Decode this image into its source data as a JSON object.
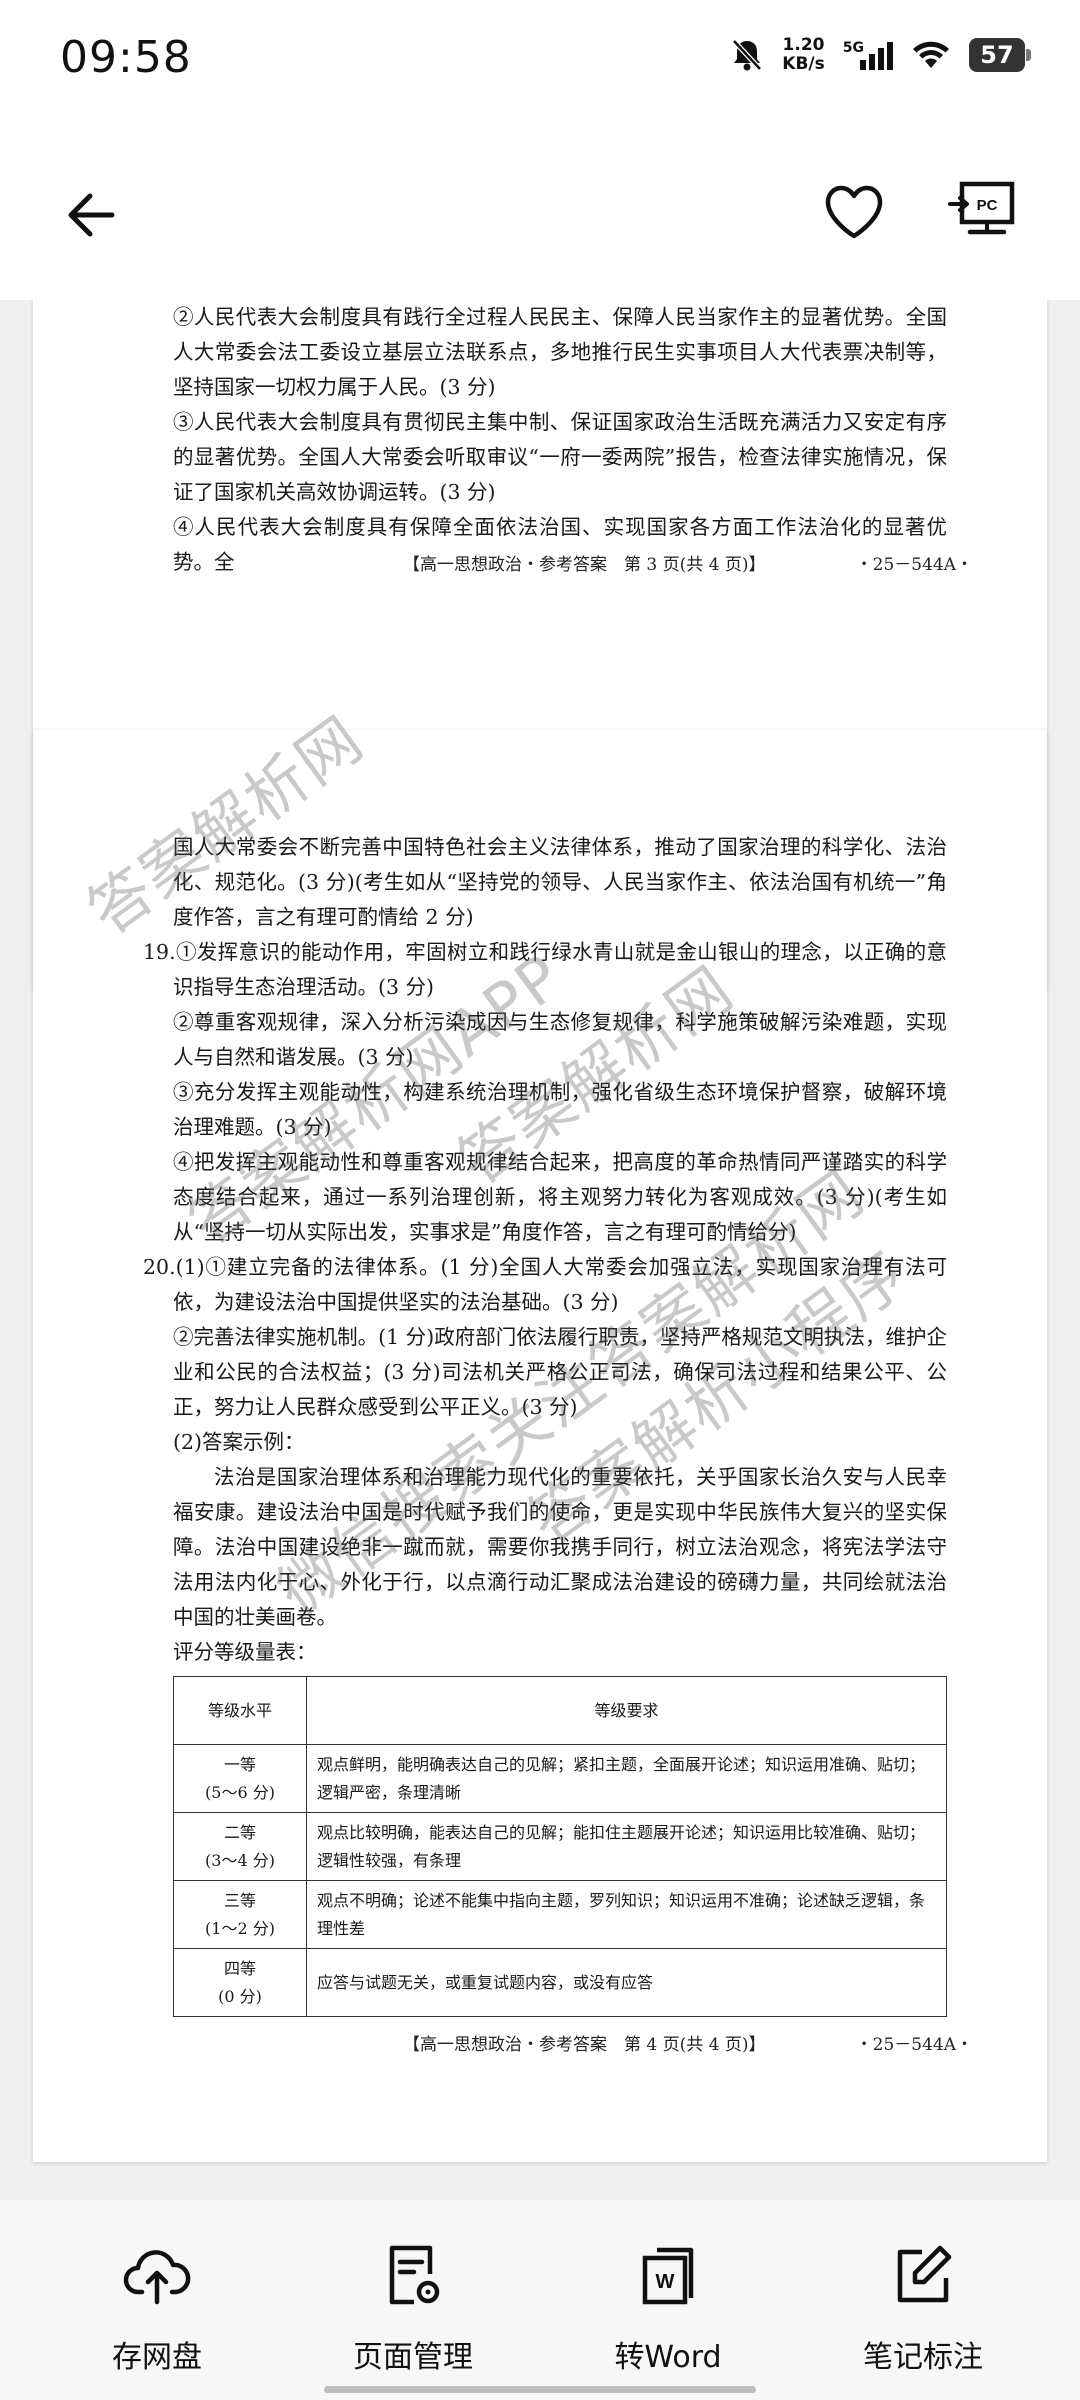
{
  "status": {
    "time": "09:58",
    "speed_value": "1.20",
    "speed_unit": "KB/s",
    "network": "5G",
    "battery": "57"
  },
  "icons": {
    "bell": "bell-off-icon",
    "signal": "signal-icon",
    "wifi": "wifi-icon",
    "battery": "battery-icon",
    "back": "back-arrow-icon",
    "favorite": "heart-icon",
    "cast": "pc-cast-icon"
  },
  "page3": {
    "lines": [
      "②人民代表大会制度具有践行全过程人民民主、保障人民当家作主的显著优势。全国人大常委会法工委设立基层立法联系点，多地推行民生实事项目人大代表票决制等，坚持国家一切权力属于人民。(3 分)",
      "③人民代表大会制度具有贯彻民主集中制、保证国家政治生活既充满活力又安定有序的显著优势。全国人大常委会听取审议“一府一委两院”报告，检查法律实施情况，保证了国家机关高效协调运转。(3 分)",
      "④人民代表大会制度具有保障全面依法治国、实现国家各方面工作法治化的显著优势。全"
    ],
    "footer_center": "【高一思想政治・参考答案　第 3 页(共 4 页)】",
    "footer_right": "・25－544A・"
  },
  "page4": {
    "intro": "国人大常委会不断完善中国特色社会主义法律体系，推动了国家治理的科学化、法治化、规范化。(3 分)(考生如从“坚持党的领导、人民当家作主、依法治国有机统一”角度作答，言之有理可酌情给 2 分)",
    "q19_num": "19.",
    "q19": [
      "①发挥意识的能动作用，牢固树立和践行绿水青山就是金山银山的理念，以正确的意识指导生态治理活动。(3 分)",
      "②尊重客观规律，深入分析污染成因与生态修复规律，科学施策破解污染难题，实现人与自然和谐发展。(3 分)",
      "③充分发挥主观能动性，构建系统治理机制，强化省级生态环境保护督察，破解环境治理难题。(3 分)",
      "④把发挥主观能动性和尊重客观规律结合起来，把高度的革命热情同严谨踏实的科学态度结合起来，通过一系列治理创新，将主观努力转化为客观成效。(3 分)(考生如从“坚持一切从实际出发，实事求是”角度作答，言之有理可酌情给分)"
    ],
    "q20_num": "20.",
    "q20": [
      "(1)①建立完备的法律体系。(1 分)全国人大常委会加强立法，实现国家治理有法可依，为建设法治中国提供坚实的法治基础。(3 分)",
      "②完善法律实施机制。(1 分)政府部门依法履行职责，坚持严格规范文明执法，维护企业和公民的合法权益；(3 分)司法机关严格公正司法，确保司法过程和结果公平、公正，努力让人民群众感受到公平正义。(3 分)",
      "(2)答案示例："
    ],
    "essay": "法治是国家治理体系和治理能力现代化的重要依托，关乎国家长治久安与人民幸福安康。建设法治中国是时代赋予我们的使命，更是实现中华民族伟大复兴的坚实保障。法治中国建设绝非一蹴而就，需要你我携手同行，树立法治观念，将宪法学法守法用法内化于心、外化于行，以点滴行动汇聚成法治建设的磅礴力量，共同绘就法治中国的壮美画卷。",
    "scale_label": "评分等级量表：",
    "table": {
      "headers": [
        "等级水平",
        "等级要求"
      ],
      "rows": [
        {
          "level": "一等",
          "score": "(5～6 分)",
          "req": "观点鲜明，能明确表达自己的见解；紧扣主题，全面展开论述；知识运用准确、贴切；逻辑严密，条理清晰"
        },
        {
          "level": "二等",
          "score": "(3～4 分)",
          "req": "观点比较明确，能表达自己的见解；能扣住主题展开论述；知识运用比较准确、贴切；逻辑性较强，有条理"
        },
        {
          "level": "三等",
          "score": "(1～2 分)",
          "req": "观点不明确；论述不能集中指向主题，罗列知识；知识运用不准确；论述缺乏逻辑，条理性差"
        },
        {
          "level": "四等",
          "score": "(0 分)",
          "req": "应答与试题无关，或重复试题内容，或没有应答"
        }
      ]
    },
    "footer_center": "【高一思想政治・参考答案　第 4 页(共 4 页)】",
    "footer_right": "・25－544A・"
  },
  "watermarks": [
    "答案解析网",
    "答案解析网APP",
    "答案解析网",
    "微信搜索关注答案解析网",
    "答案解析小程序"
  ],
  "toolbar": [
    {
      "label": "存网盘",
      "icon": "cloud-upload-icon"
    },
    {
      "label": "页面管理",
      "icon": "page-manage-icon"
    },
    {
      "label": "转Word",
      "icon": "word-convert-icon"
    },
    {
      "label": "笔记标注",
      "icon": "note-edit-icon"
    }
  ]
}
